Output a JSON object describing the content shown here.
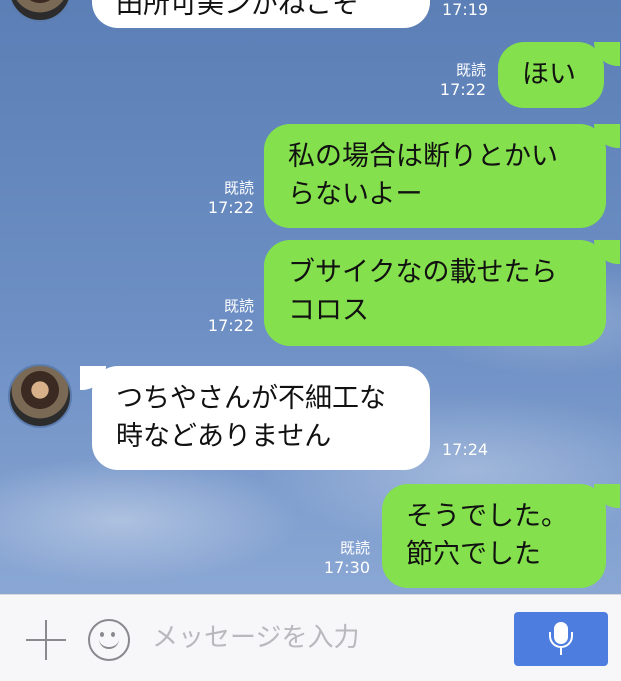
{
  "messages": [
    {
      "side": "in",
      "text": "田所可美ンがねこそ",
      "time": "17:19"
    },
    {
      "side": "out",
      "read": "既読",
      "text": "ほい",
      "time": "17:22"
    },
    {
      "side": "out",
      "read": "既読",
      "text": "私の場合は断りとかい\nらないよー",
      "time": "17:22"
    },
    {
      "side": "out",
      "read": "既読",
      "text": "ブサイクなの載せたら\nコロス",
      "time": "17:22"
    },
    {
      "side": "in",
      "text": "つちやさんが不細工な\n時などありません",
      "time": "17:24"
    },
    {
      "side": "out",
      "read": "既読",
      "text": "そうでした。\n節穴でした",
      "time": "17:30"
    }
  ],
  "composer": {
    "placeholder": "メッセージを入力",
    "plus_icon": "plus-icon",
    "emoji_icon": "smiley-icon",
    "mic_icon": "microphone-icon"
  },
  "colors": {
    "outgoing_bubble": "#84e04c",
    "incoming_bubble": "#ffffff",
    "mic_button": "#4e7de0"
  }
}
